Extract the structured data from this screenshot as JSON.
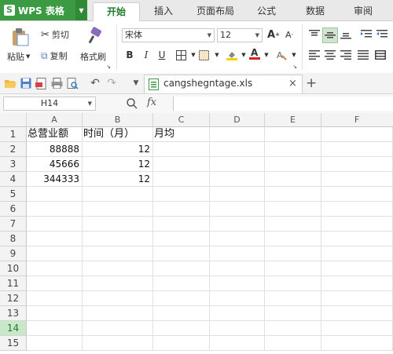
{
  "app": {
    "name": "WPS 表格"
  },
  "tabs": [
    "开始",
    "插入",
    "页面布局",
    "公式",
    "数据",
    "审阅"
  ],
  "active_tab": "开始",
  "ribbon": {
    "paste_label": "粘贴",
    "cut_label": "剪切",
    "copy_label": "复制",
    "format_painter_label": "格式刷",
    "font_name": "宋体",
    "font_size": "12",
    "bold": "B",
    "italic": "I",
    "underline": "U",
    "grow_font": "A",
    "shrink_font": "A"
  },
  "file_tab": {
    "name": "cangshegntage.xls",
    "close": "×",
    "new": "+"
  },
  "formula_bar": {
    "cell_ref": "H14",
    "fx": "fx",
    "value": ""
  },
  "columns": [
    "A",
    "B",
    "C",
    "D",
    "E",
    "F"
  ],
  "rows": [
    "1",
    "2",
    "3",
    "4",
    "5",
    "6",
    "7",
    "8",
    "9",
    "10",
    "11",
    "12",
    "13",
    "14",
    "15"
  ],
  "selected_row": "14",
  "cells": {
    "A1": "总营业额",
    "B1": "时间（月）",
    "C1": "月均",
    "A2": "88888",
    "B2": "12",
    "A3": "45666",
    "B3": "12",
    "A4": "344333",
    "B4": "12"
  },
  "colors": {
    "brand": "#3c9a43",
    "active_tab_text": "#1f7a2d",
    "selected_row": "#c9e7c9"
  }
}
